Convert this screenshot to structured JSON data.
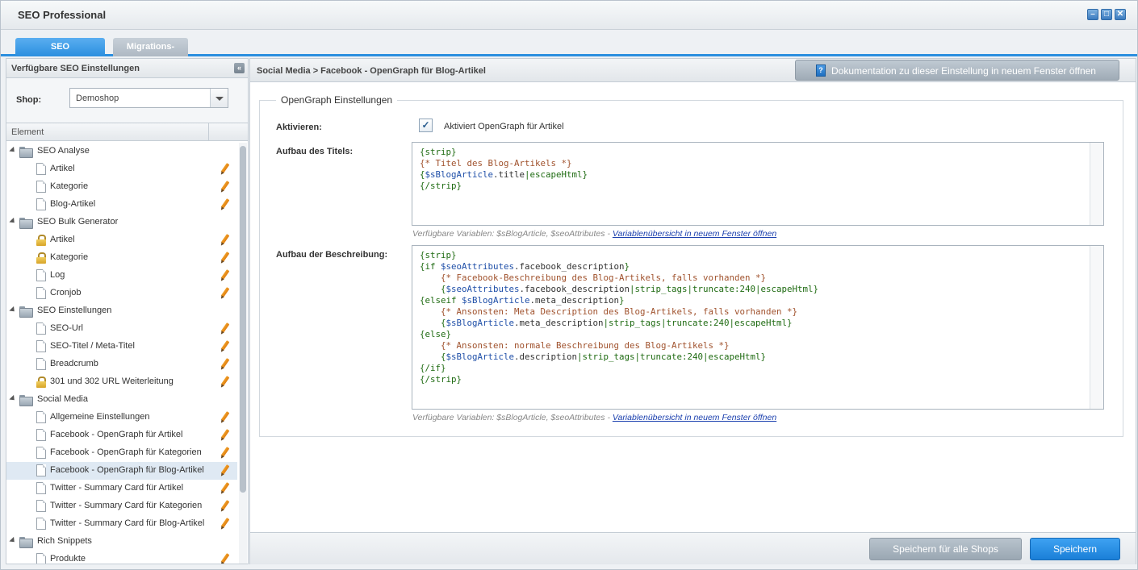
{
  "window": {
    "title": "SEO Professional"
  },
  "tabs": [
    {
      "label": "SEO Einstellungen",
      "active": true
    },
    {
      "label": "Migrations-Tool",
      "active": false
    }
  ],
  "sidebar": {
    "title": "Verfügbare SEO Einstellungen",
    "shop_label": "Shop:",
    "shop_value": "Demoshop",
    "column_header": "Element",
    "groups": [
      {
        "label": "SEO Analyse",
        "items": [
          {
            "label": "Artikel",
            "icon": "page-icon"
          },
          {
            "label": "Kategorie",
            "icon": "page-icon"
          },
          {
            "label": "Blog-Artikel",
            "icon": "page-icon"
          }
        ]
      },
      {
        "label": "SEO Bulk Generator",
        "items": [
          {
            "label": "Artikel",
            "icon": "lock-icon"
          },
          {
            "label": "Kategorie",
            "icon": "lock-icon"
          },
          {
            "label": "Log",
            "icon": "page-icon"
          },
          {
            "label": "Cronjob",
            "icon": "page-icon"
          }
        ]
      },
      {
        "label": "SEO Einstellungen",
        "items": [
          {
            "label": "SEO-Url",
            "icon": "page-icon"
          },
          {
            "label": "SEO-Titel / Meta-Titel",
            "icon": "page-icon"
          },
          {
            "label": "Breadcrumb",
            "icon": "page-icon"
          },
          {
            "label": "301 und 302 URL Weiterleitung",
            "icon": "lock-icon"
          }
        ]
      },
      {
        "label": "Social Media",
        "items": [
          {
            "label": "Allgemeine Einstellungen",
            "icon": "page-icon"
          },
          {
            "label": "Facebook - OpenGraph für Artikel",
            "icon": "page-icon"
          },
          {
            "label": "Facebook - OpenGraph für Kategorien",
            "icon": "page-icon"
          },
          {
            "label": "Facebook - OpenGraph für Blog-Artikel",
            "icon": "page-icon",
            "selected": true
          },
          {
            "label": "Twitter - Summary Card für Artikel",
            "icon": "page-icon"
          },
          {
            "label": "Twitter - Summary Card für Kategorien",
            "icon": "page-icon"
          },
          {
            "label": "Twitter - Summary Card für Blog-Artikel",
            "icon": "page-icon"
          }
        ]
      },
      {
        "label": "Rich Snippets",
        "items": [
          {
            "label": "Produkte",
            "icon": "page-icon"
          }
        ]
      }
    ]
  },
  "main": {
    "breadcrumb": "Social Media > Facebook - OpenGraph für Blog-Artikel",
    "doc_button": "Dokumentation zu dieser Einstellung in neuem Fenster öffnen",
    "fieldset_legend": "OpenGraph Einstellungen",
    "activate_label": "Aktivieren:",
    "activate_checkbox_text": "Aktiviert OpenGraph für Artikel",
    "activate_checked": true,
    "title_label": "Aufbau des Titels:",
    "title_code": [
      [
        [
          "g",
          "{strip}"
        ]
      ],
      [
        [
          "c",
          "{* Titel des Blog-Artikels *}"
        ]
      ],
      [
        [
          "g",
          "{"
        ],
        [
          "v",
          "$sBlogArticle"
        ],
        [
          "p",
          ".title"
        ],
        [
          "g",
          "|escapeHtml}"
        ]
      ],
      [
        [
          "g",
          "{/strip}"
        ]
      ]
    ],
    "vars_hint": "Verfügbare Variablen: $sBlogArticle, $seoAttributes - ",
    "vars_link": "Variablenübersicht in neuem Fenster öffnen",
    "description_label": "Aufbau der Beschreibung:",
    "description_code": [
      [
        [
          "g",
          "{strip}"
        ]
      ],
      [
        [
          "g",
          "{if "
        ],
        [
          "v",
          "$seoAttributes"
        ],
        [
          "p",
          ".facebook_description"
        ],
        [
          "g",
          "}"
        ]
      ],
      [
        [
          "g",
          "    "
        ],
        [
          "c",
          "{* Facebook-Beschreibung des Blog-Artikels, falls vorhanden *}"
        ]
      ],
      [
        [
          "g",
          "    {"
        ],
        [
          "v",
          "$seoAttributes"
        ],
        [
          "p",
          ".facebook_description"
        ],
        [
          "g",
          "|strip_tags|truncate:240|escapeHtml}"
        ]
      ],
      [
        [
          "g",
          "{elseif "
        ],
        [
          "v",
          "$sBlogArticle"
        ],
        [
          "p",
          ".meta_description"
        ],
        [
          "g",
          "}"
        ]
      ],
      [
        [
          "g",
          "    "
        ],
        [
          "c",
          "{* Ansonsten: Meta Description des Blog-Artikels, falls vorhanden *}"
        ]
      ],
      [
        [
          "g",
          "    {"
        ],
        [
          "v",
          "$sBlogArticle"
        ],
        [
          "p",
          ".meta_description"
        ],
        [
          "g",
          "|strip_tags|truncate:240|escapeHtml}"
        ]
      ],
      [
        [
          "g",
          "{else}"
        ]
      ],
      [
        [
          "g",
          "    "
        ],
        [
          "c",
          "{* Ansonsten: normale Beschreibung des Blog-Artikels *}"
        ]
      ],
      [
        [
          "g",
          "    {"
        ],
        [
          "v",
          "$sBlogArticle"
        ],
        [
          "p",
          ".description"
        ],
        [
          "g",
          "|strip_tags|truncate:240|escapeHtml}"
        ]
      ],
      [
        [
          "g",
          "{/if}"
        ]
      ],
      [
        [
          "g",
          "{/strip}"
        ]
      ]
    ]
  },
  "footer": {
    "save_all_label": "Speichern für alle Shops",
    "save_label": "Speichern"
  }
}
